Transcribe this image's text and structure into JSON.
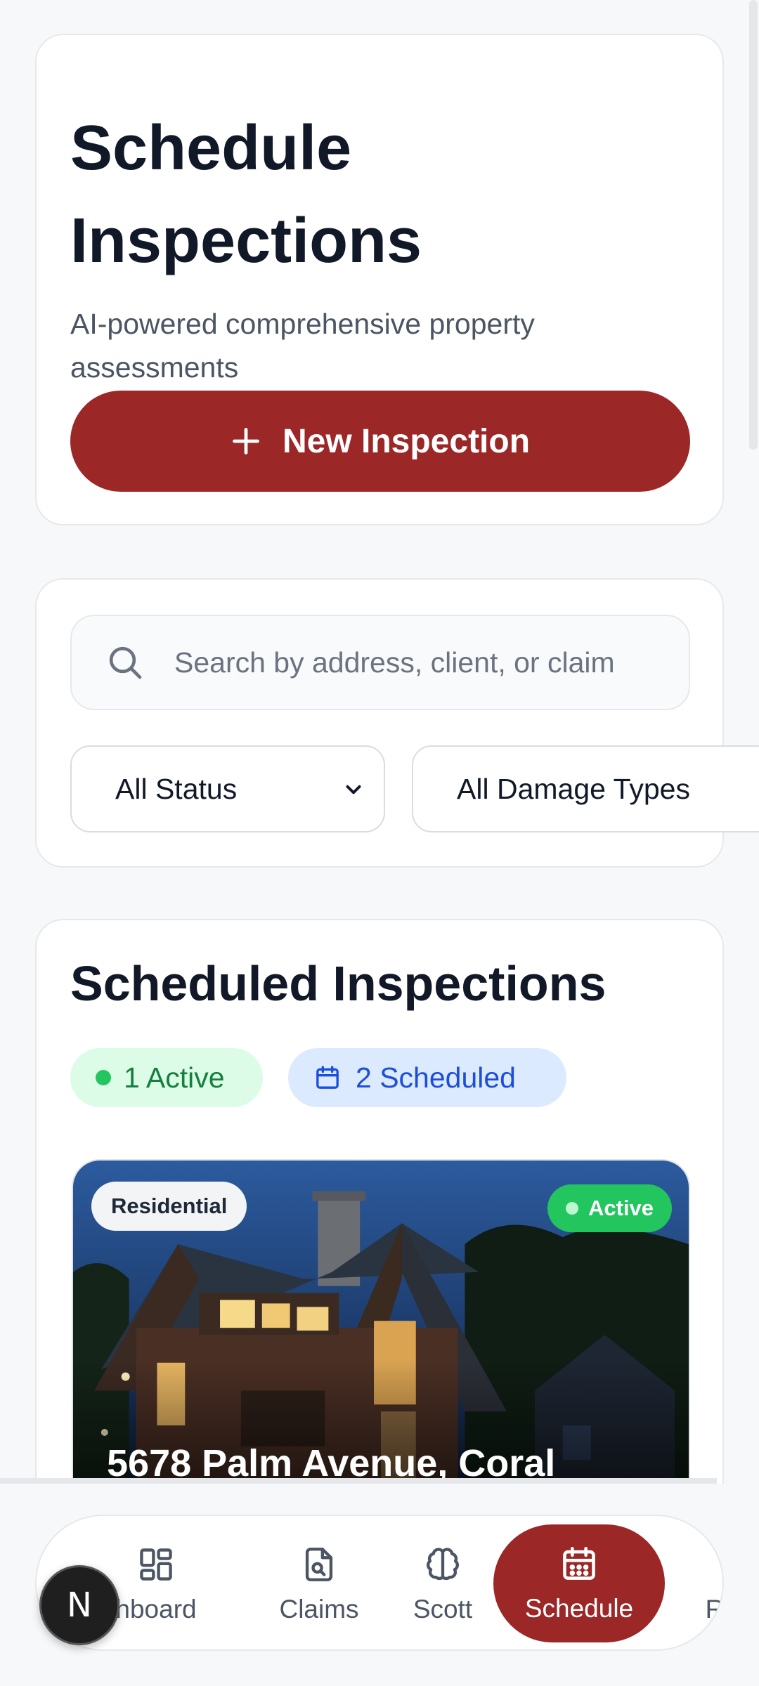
{
  "header": {
    "title": "Schedule Inspections",
    "subtitle": "AI-powered comprehensive property assessments",
    "new_inspection_label": "New Inspection"
  },
  "filters": {
    "search_placeholder": "Search by address, client, or claim",
    "status_value": "All Status",
    "damage_value": "All Damage Types"
  },
  "scheduled": {
    "title": "Scheduled Inspections",
    "active_label": "1 Active",
    "scheduled_label": "2 Scheduled",
    "property": {
      "type": "Residential",
      "status": "Active",
      "address": "5678 Palm Avenue, Coral"
    }
  },
  "nav": {
    "items": [
      {
        "label": "hboard"
      },
      {
        "label": "Claims"
      },
      {
        "label": "Scott"
      },
      {
        "label": "Schedule"
      },
      {
        "label": "Repor"
      }
    ]
  },
  "dev_badge": "N",
  "colors": {
    "primary": "#9b2727",
    "active_green": "#22c55e",
    "scheduled_blue": "#1d4ed8"
  }
}
